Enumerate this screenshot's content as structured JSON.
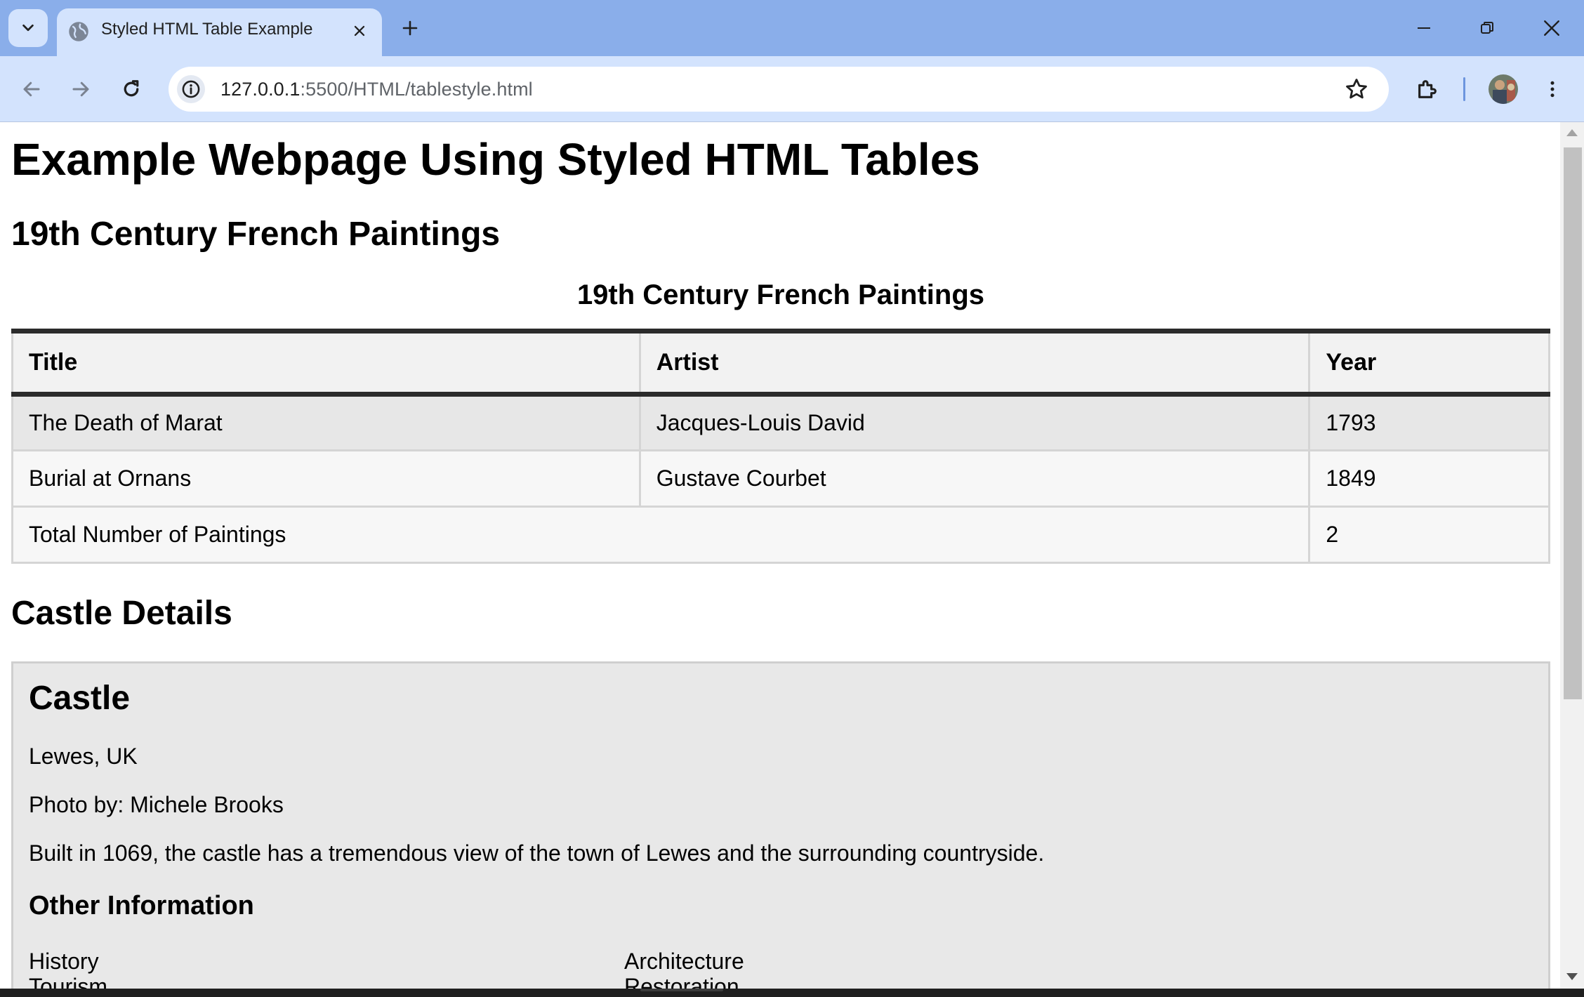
{
  "browser": {
    "tab_title": "Styled HTML Table Example",
    "url_host": "127.0.0.1",
    "url_rest": ":5500/HTML/tablestyle.html",
    "accent": "#8aaeea",
    "toolbar_color": "#d3e3fd"
  },
  "page": {
    "title": "Example Webpage Using Styled HTML Tables",
    "paintings_heading": "19th Century French Paintings",
    "table": {
      "caption": "19th Century French Paintings",
      "headers": [
        "Title",
        "Artist",
        "Year"
      ],
      "rows": [
        {
          "title": "The Death of Marat",
          "artist": "Jacques-Louis David",
          "year": "1793"
        },
        {
          "title": "Burial at Ornans",
          "artist": "Gustave Courbet",
          "year": "1849"
        }
      ],
      "footer_label": "Total Number of Paintings",
      "footer_value": "2"
    },
    "castle_heading": "Castle Details",
    "castle": {
      "title": "Castle",
      "location": "Lewes, UK",
      "photo": "Photo by: Michele Brooks",
      "description": "Built in 1069, the castle has a tremendous view of the town of Lewes and the surrounding countryside.",
      "other_heading": "Other Information",
      "tags": [
        "History",
        "Architecture",
        "Tourism",
        "Restoration"
      ]
    }
  }
}
